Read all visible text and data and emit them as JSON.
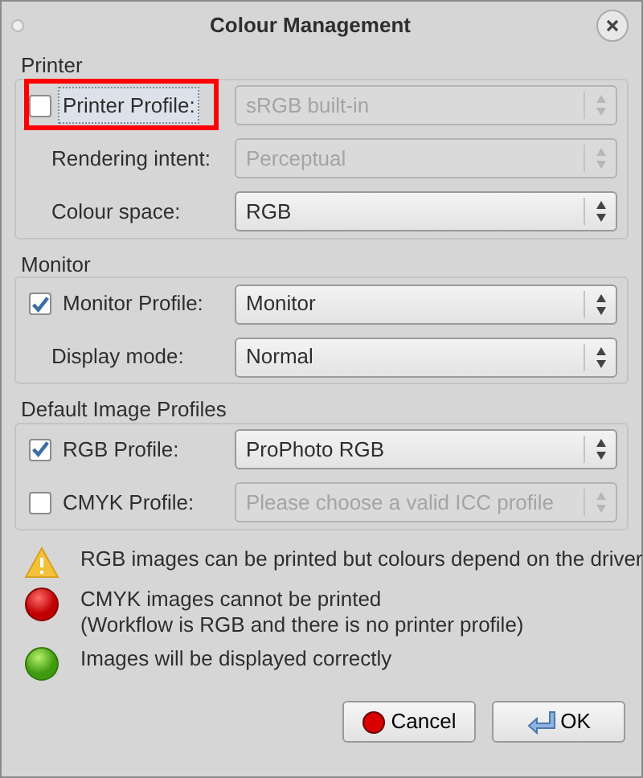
{
  "window": {
    "title": "Colour Management"
  },
  "groups": [
    {
      "title": "Printer",
      "rows": [
        {
          "kind": "checkbox",
          "label": "Printer Profile:",
          "checked": false,
          "focused": true,
          "highlighted": true,
          "value": "sRGB built-in",
          "disabled": true
        },
        {
          "kind": "label",
          "label": "Rendering intent:",
          "value": "Perceptual",
          "disabled": true
        },
        {
          "kind": "label",
          "label": "Colour space:",
          "value": "RGB",
          "disabled": false
        }
      ]
    },
    {
      "title": "Monitor",
      "rows": [
        {
          "kind": "checkbox",
          "label": "Monitor Profile:",
          "checked": true,
          "focused": false,
          "highlighted": false,
          "value": "Monitor",
          "disabled": false
        },
        {
          "kind": "label",
          "label": "Display mode:",
          "value": "Normal",
          "disabled": false
        }
      ]
    },
    {
      "title": "Default Image Profiles",
      "rows": [
        {
          "kind": "checkbox",
          "label": "RGB Profile:",
          "checked": true,
          "focused": false,
          "highlighted": false,
          "value": "ProPhoto RGB",
          "disabled": false
        },
        {
          "kind": "checkbox",
          "label": "CMYK Profile:",
          "checked": false,
          "focused": false,
          "highlighted": false,
          "placeholder": "Please choose a valid ICC profile",
          "disabled": true
        }
      ]
    }
  ],
  "messages": [
    {
      "kind": "warning",
      "lines": [
        "RGB images can be printed but colours depend on the driver"
      ]
    },
    {
      "kind": "error",
      "lines": [
        "CMYK images cannot be printed",
        "(Workflow is RGB and there is no printer profile)"
      ]
    },
    {
      "kind": "ok",
      "lines": [
        "Images will be displayed correctly"
      ]
    }
  ],
  "buttons": [
    {
      "kind": "cancel",
      "label": "Cancel"
    },
    {
      "kind": "ok",
      "label": "OK"
    }
  ]
}
